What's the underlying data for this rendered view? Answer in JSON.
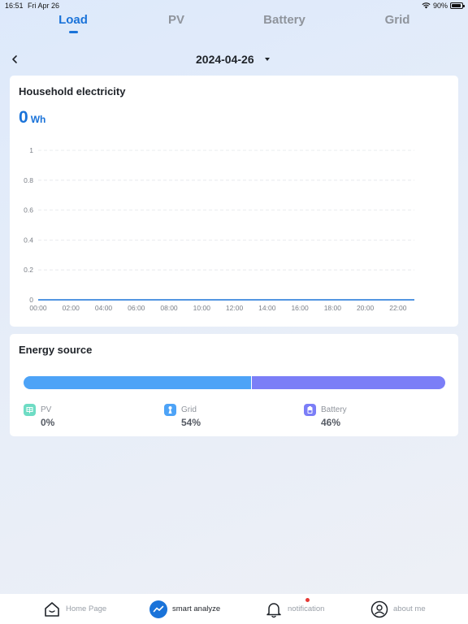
{
  "status_bar": {
    "time": "16:51",
    "date": "Fri Apr 26",
    "battery_pct": "90%",
    "battery_level": 0.9
  },
  "tabs": [
    {
      "label": "Load",
      "active": true
    },
    {
      "label": "PV",
      "active": false
    },
    {
      "label": "Battery",
      "active": false
    },
    {
      "label": "Grid",
      "active": false
    }
  ],
  "date_selector": {
    "date": "2024-04-26"
  },
  "load_card": {
    "title": "Household electricity",
    "value": "0",
    "unit": "Wh",
    "chart_data": {
      "type": "line",
      "x": [
        "00:00",
        "02:00",
        "04:00",
        "06:00",
        "08:00",
        "10:00",
        "12:00",
        "14:00",
        "16:00",
        "18:00",
        "20:00",
        "22:00"
      ],
      "y_ticks": [
        "0",
        "0.2",
        "0.4",
        "0.6",
        "0.8",
        "1"
      ],
      "ylim": [
        0,
        1
      ],
      "series": [
        {
          "values": [
            0,
            0,
            0,
            0,
            0,
            0,
            0,
            0,
            0,
            0,
            0,
            0,
            0
          ],
          "color": "#1a73d9"
        }
      ],
      "grid": true
    }
  },
  "energy_source": {
    "title": "Energy source",
    "items": [
      {
        "name": "PV",
        "pct_label": "0%",
        "fraction": 0.0,
        "color": "#6edcc4",
        "icon": "solar-panel-icon"
      },
      {
        "name": "Grid",
        "pct_label": "54%",
        "fraction": 0.54,
        "color": "#4da3f7",
        "icon": "grid-tower-icon"
      },
      {
        "name": "Battery",
        "pct_label": "46%",
        "fraction": 0.46,
        "color": "#7b7ef7",
        "icon": "battery-icon"
      }
    ]
  },
  "bottom_nav": [
    {
      "label": "Home Page",
      "icon": "home-icon",
      "active": false
    },
    {
      "label": "smart analyze",
      "icon": "analyze-icon",
      "active": true
    },
    {
      "label": "notification",
      "icon": "bell-icon",
      "active": false,
      "has_badge": true
    },
    {
      "label": "about me",
      "icon": "user-icon",
      "active": false
    }
  ],
  "colors": {
    "accent": "#1a73d9",
    "muted": "#8f949c",
    "badge": "#e53935"
  }
}
